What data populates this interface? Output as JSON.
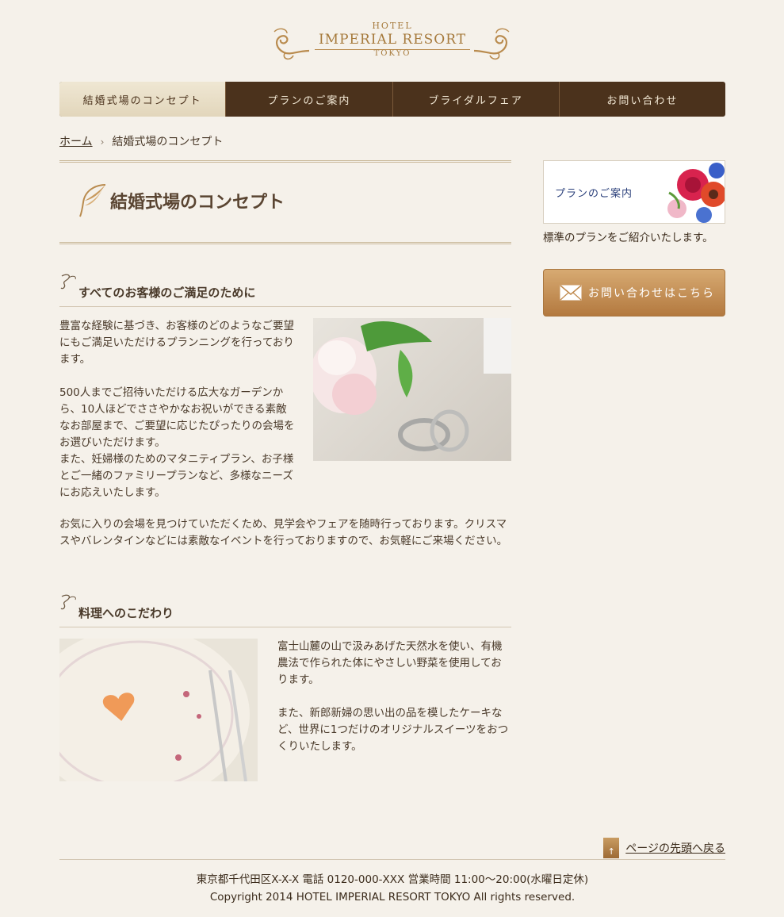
{
  "logo": {
    "hotel": "HOTEL",
    "name": "IMPERIAL RESORT",
    "city": "TOKYO"
  },
  "nav": [
    {
      "label": "結婚式場のコンセプト"
    },
    {
      "label": "プランのご案内"
    },
    {
      "label": "ブライダルフェア"
    },
    {
      "label": "お問い合わせ"
    }
  ],
  "breadcrumb": {
    "home": "ホーム",
    "current": "結婚式場のコンセプト"
  },
  "page": {
    "title": "結婚式場のコンセプト",
    "section1": {
      "heading": "すべてのお客様のご満足のために",
      "p1": "豊富な経験に基づき、お客様のどのようなご要望にもご満足いただけるプランニングを行っております。",
      "p2a": "500人までご招待いただける広大なガーデンから、10人ほどでささやかなお祝いができる素敵なお部屋まで、ご要望に応じたぴったりの会場をお選びいただけます。",
      "p2b": "また、妊婦様のためのマタニティプラン、お子様とご一緒のファミリープランなど、多様なニーズにお応えいたします。",
      "p3": "お気に入りの会場を見つけていただくため、見学会やフェアを随時行っております。クリスマスやバレンタインなどには素敵なイベントを行っておりますので、お気軽にご来場ください。"
    },
    "section2": {
      "heading": "料理へのこだわり",
      "p1": "富士山麓の山で汲みあげた天然水を使い、有機農法で作られた体にやさしい野菜を使用しております。",
      "p2": "また、新郎新婦の思い出の品を模したケーキなど、世界に1つだけのオリジナルスイーツをおつくりいたします。"
    }
  },
  "sidebar": {
    "plan_banner": "プランのご案内",
    "plan_desc": "標準のプランをご紹介いたします。",
    "contact": "お問い合わせはこちら"
  },
  "footer": {
    "totop_arrow": "↑",
    "totop": "ページの先頭へ戻る",
    "address": "東京都千代田区X-X-X 電話 0120-000-XXX 営業時間 11:00〜20:00(水曜日定休)",
    "copyright": "Copyright 2014 HOTEL IMPERIAL RESORT TOKYO All rights reserved."
  }
}
